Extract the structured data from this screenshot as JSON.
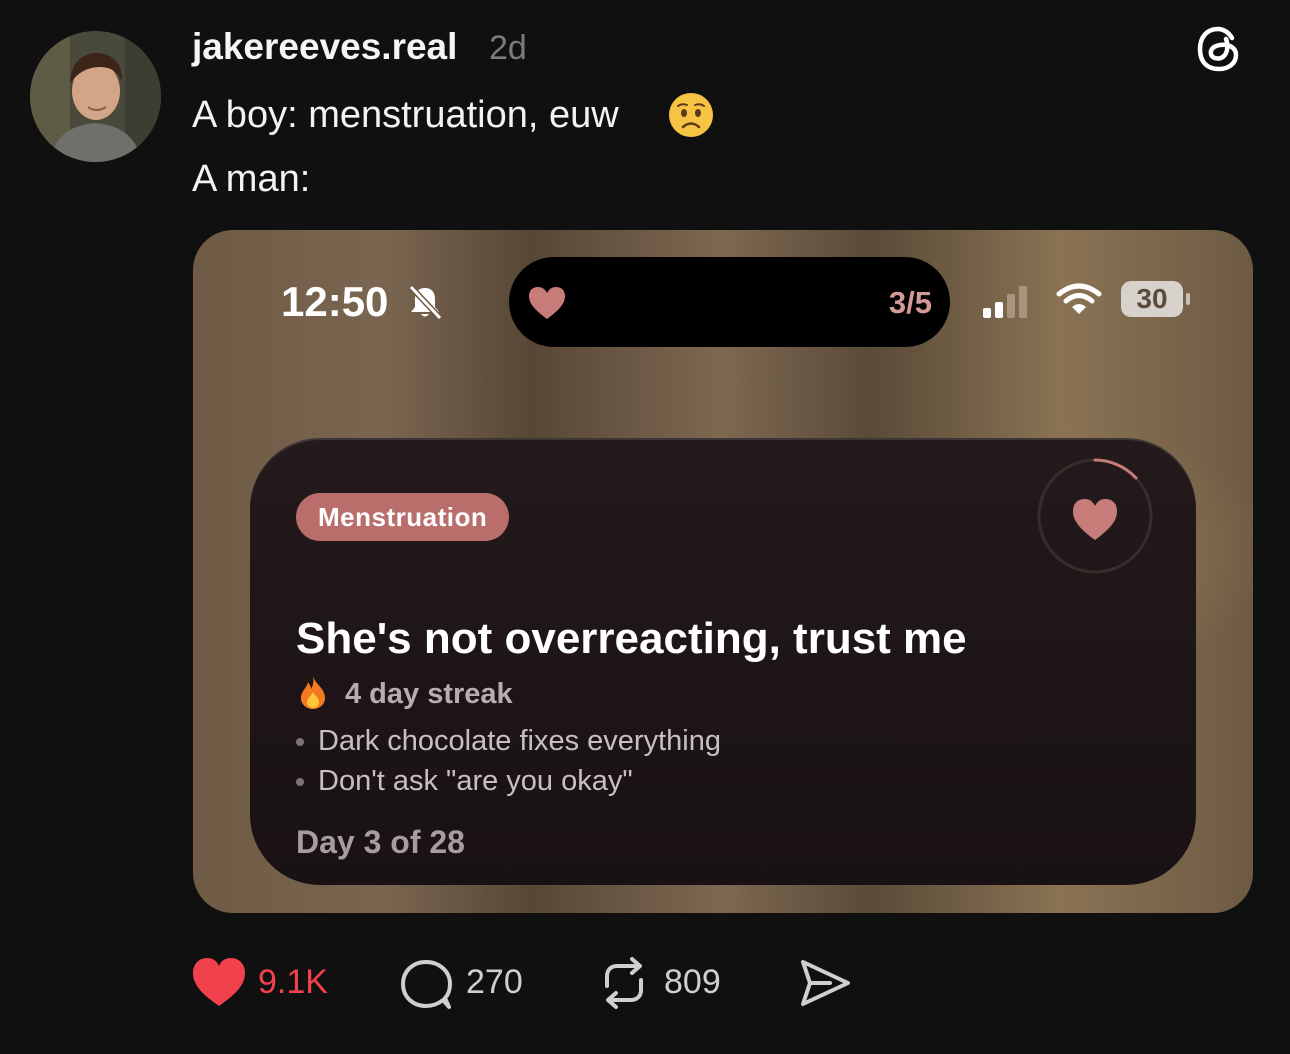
{
  "post": {
    "username": "jakereeves.real",
    "time": "2d",
    "line1": "A boy: menstruation, euw",
    "line2": "A man:"
  },
  "media": {
    "status_bar": {
      "time": "12:50",
      "island_count": "3/5",
      "battery": "30"
    },
    "card": {
      "tag": "Menstruation",
      "title": "She's not overreacting, trust me",
      "streak": "4 day streak",
      "bullets": [
        "Dark chocolate fixes everything",
        "Don't ask \"are you okay\""
      ],
      "day": "Day 3 of 28"
    }
  },
  "actions": {
    "likes": "9.1K",
    "comments": "270",
    "reposts": "809"
  },
  "colors": {
    "like_red": "#f0414c",
    "tag_bg": "#b96e6c",
    "heart_pink": "#c77c79",
    "background": "#101010"
  },
  "icons": [
    "threads-logo-icon",
    "worried-face-emoji",
    "bell-slash-icon",
    "heart-icon",
    "signal-icon",
    "wifi-icon",
    "battery-icon",
    "fire-icon",
    "comment-icon",
    "repost-icon",
    "share-icon"
  ]
}
